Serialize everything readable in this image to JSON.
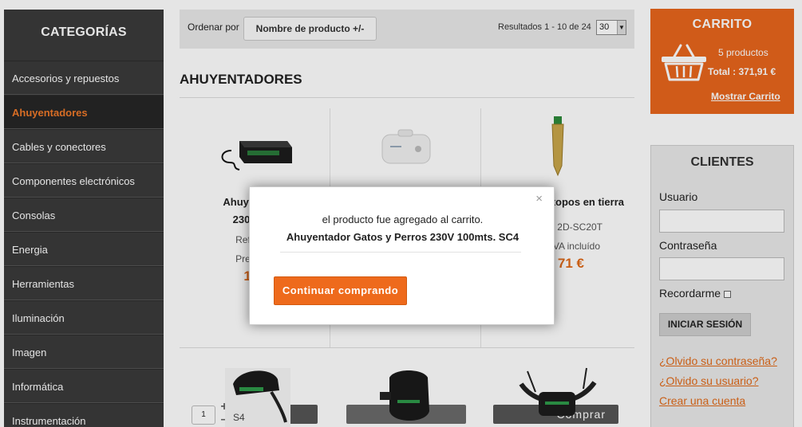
{
  "sidebar": {
    "title": "CATEGORÍAS",
    "items": [
      {
        "label": "Accesorios y repuestos",
        "active": false
      },
      {
        "label": "Ahuyentadores",
        "active": true
      },
      {
        "label": "Cables y conectores",
        "active": false
      },
      {
        "label": "Componentes electrónicos",
        "active": false
      },
      {
        "label": "Consolas",
        "active": false
      },
      {
        "label": "Energia",
        "active": false
      },
      {
        "label": "Herramientas",
        "active": false
      },
      {
        "label": "Iluminación",
        "active": false
      },
      {
        "label": "Imagen",
        "active": false
      },
      {
        "label": "Informática",
        "active": false
      },
      {
        "label": "Instrumentación",
        "active": false
      }
    ]
  },
  "toolbar": {
    "order_label": "Ordenar por",
    "order_button": "Nombre de producto +/-",
    "results": "Resultados 1 - 10 de 24",
    "per_page": "30"
  },
  "section_title": "AHUYENTADORES",
  "products": [
    {
      "name_line1": "Ahuyentador",
      "name_line2": "230V 100",
      "ref": "Referenc",
      "price_label": "Precio IV",
      "price": "106",
      "qty": "1"
    },
    {
      "name_line1": "",
      "name_line2": "",
      "ref": "",
      "price_label": "",
      "price": "",
      "qty": ""
    },
    {
      "name_line1": "topos en tierra",
      "name_line2": "",
      "ref": ": 2D-SC20T",
      "price_label": "VA incluído",
      "price": "71 €",
      "buy": "Comprar"
    }
  ],
  "cart": {
    "title": "CARRITO",
    "count": "5 productos",
    "total": "Total : 371,91 €",
    "link": "Mostrar Carrito"
  },
  "clients": {
    "title": "CLIENTES",
    "user_label": "Usuario",
    "pass_label": "Contraseña",
    "remember": "Recordarme",
    "login": "INICIAR SESIÓN",
    "forgot_pass": "¿Olvido su contraseña?",
    "forgot_user": "¿Olvido su usuario?",
    "create": "Crear una cuenta"
  },
  "modal": {
    "close": "×",
    "message": "el producto fue agregado al carrito.",
    "product": "Ahuyentador Gatos y Perros 230V 100mts. SC4",
    "button": "Continuar comprando"
  },
  "colors": {
    "accent": "#e8661c",
    "sidebar_bg": "#3a3a3a"
  }
}
